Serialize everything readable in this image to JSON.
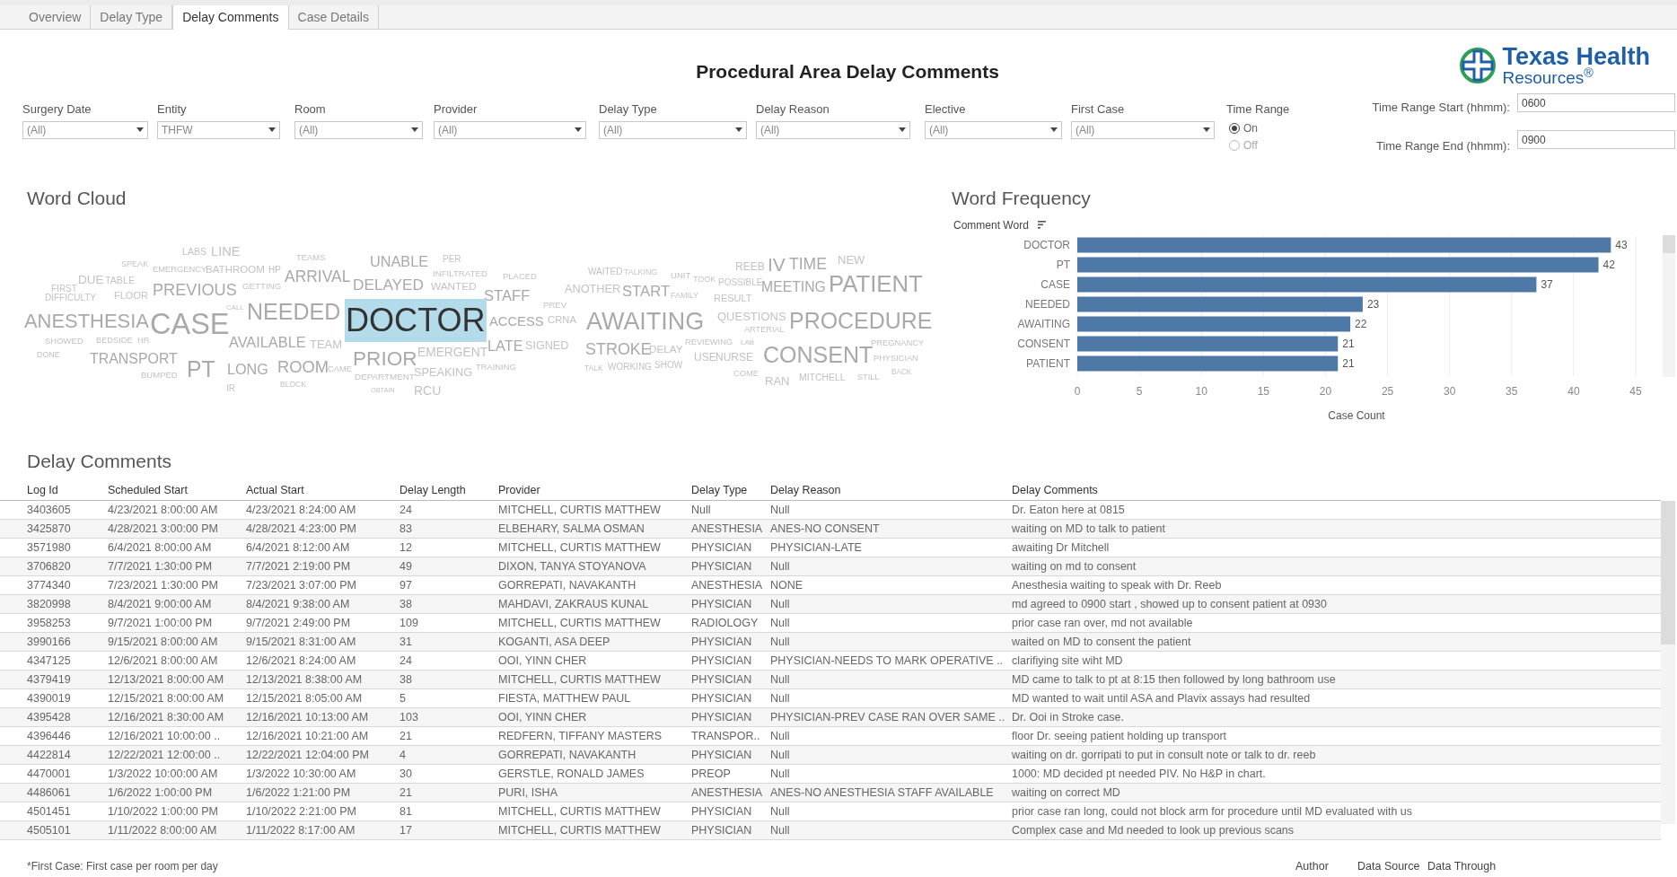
{
  "tabs": [
    {
      "label": "Overview",
      "selected": false
    },
    {
      "label": "Delay Type",
      "selected": false
    },
    {
      "label": "Delay Comments",
      "selected": true
    },
    {
      "label": "Case Details",
      "selected": false
    }
  ],
  "title": "Procedural Area Delay Comments",
  "logo": {
    "line_1": "Texas Health",
    "line_2": "Resources$^{®}$"
  },
  "filters": [
    {
      "label": "Surgery Date",
      "value": "(All)"
    },
    {
      "label": "Entity",
      "value": "THFW"
    },
    {
      "label": "Room",
      "value": "(All)"
    },
    {
      "label": "Provider",
      "value": "(All)"
    },
    {
      "label": "Delay Type",
      "value": "(All)"
    },
    {
      "label": "Delay Reason",
      "value": "(All)"
    },
    {
      "label": "Elective",
      "value": "(All)"
    },
    {
      "label": "First Case",
      "value": "(All)"
    }
  ],
  "time_range": {
    "label": "Time Range",
    "options": [
      {
        "label": "On",
        "selected": true
      },
      {
        "label": "Off",
        "selected": false
      }
    ]
  },
  "time_inputs": [
    {
      "label": "Time Range Start (hhmm):",
      "value": "0600"
    },
    {
      "label": "Time Range End (hhmm):",
      "value": "0900"
    }
  ],
  "word_cloud": {
    "title": "Word Cloud",
    "words": [
      {
        "text": "LABS",
        "selected": false
      },
      {
        "text": "LINE",
        "selected": false
      },
      {
        "text": "TEAMS",
        "selected": false
      },
      {
        "text": "UNABLE",
        "selected": false
      },
      {
        "text": "PER",
        "selected": false
      },
      {
        "text": "SPEAK",
        "selected": false
      },
      {
        "text": "EMERGENCY",
        "selected": false
      },
      {
        "text": "BATHROOM",
        "selected": false
      },
      {
        "text": "HP",
        "selected": false
      },
      {
        "text": "ARRIVAL",
        "selected": false
      },
      {
        "text": "INFILTRATED",
        "selected": false
      },
      {
        "text": "PLACED",
        "selected": false
      },
      {
        "text": "WAITED",
        "selected": false
      },
      {
        "text": "TALKING",
        "selected": false
      },
      {
        "text": "UNIT",
        "selected": false
      },
      {
        "text": "TOOK",
        "selected": false
      },
      {
        "text": "REEB",
        "selected": false
      },
      {
        "text": "IV",
        "selected": false
      },
      {
        "text": "TIME",
        "selected": false
      },
      {
        "text": "NEW",
        "selected": false
      },
      {
        "text": "FIRST",
        "selected": false
      },
      {
        "text": "DUE",
        "selected": false
      },
      {
        "text": "TABLE",
        "selected": false
      },
      {
        "text": "DIFFICULTY",
        "selected": false
      },
      {
        "text": "FLOOR",
        "selected": false
      },
      {
        "text": "PREVIOUS",
        "selected": false
      },
      {
        "text": "GETTING",
        "selected": false
      },
      {
        "text": "DELAYED",
        "selected": false
      },
      {
        "text": "WANTED",
        "selected": false
      },
      {
        "text": "STAFF",
        "selected": false
      },
      {
        "text": "ANOTHER",
        "selected": false
      },
      {
        "text": "START",
        "selected": false
      },
      {
        "text": "FAMILY",
        "selected": false
      },
      {
        "text": "POSSIBLE",
        "selected": false
      },
      {
        "text": "RESULT",
        "selected": false
      },
      {
        "text": "MEETING",
        "selected": false
      },
      {
        "text": "PATIENT",
        "selected": false
      },
      {
        "text": "ANESTHESIA",
        "selected": false
      },
      {
        "text": "CASE",
        "selected": false
      },
      {
        "text": "CALL",
        "selected": false
      },
      {
        "text": "NEEDED",
        "selected": false
      },
      {
        "text": "DOCTOR",
        "selected": true
      },
      {
        "text": "ACCESS",
        "selected": false
      },
      {
        "text": "PREV",
        "selected": false
      },
      {
        "text": "CRNA",
        "selected": false
      },
      {
        "text": "AWAITING",
        "selected": false
      },
      {
        "text": "QUESTIONS",
        "selected": false
      },
      {
        "text": "ARTERIAL",
        "selected": false
      },
      {
        "text": "PROCEDURE",
        "selected": false
      },
      {
        "text": "SHOWED",
        "selected": false
      },
      {
        "text": "BEDSIDE",
        "selected": false
      },
      {
        "text": "HR",
        "selected": false
      },
      {
        "text": "AVAILABLE",
        "selected": false
      },
      {
        "text": "TEAM",
        "selected": false
      },
      {
        "text": "LATE",
        "selected": false
      },
      {
        "text": "SIGNED",
        "selected": false
      },
      {
        "text": "STROKE",
        "selected": false
      },
      {
        "text": "DELAY",
        "selected": false
      },
      {
        "text": "REVIEWING",
        "selected": false
      },
      {
        "text": "LAB",
        "selected": false
      },
      {
        "text": "PREGNANCY",
        "selected": false
      },
      {
        "text": "DONE",
        "selected": false
      },
      {
        "text": "TRANSPORT",
        "selected": false
      },
      {
        "text": "BUMPED",
        "selected": false
      },
      {
        "text": "PT",
        "selected": false
      },
      {
        "text": "LONG",
        "selected": false
      },
      {
        "text": "IR",
        "selected": false
      },
      {
        "text": "ROOM",
        "selected": false
      },
      {
        "text": "BLOCK",
        "selected": false
      },
      {
        "text": "CAME",
        "selected": false
      },
      {
        "text": "PRIOR",
        "selected": false
      },
      {
        "text": "EMERGENT",
        "selected": false
      },
      {
        "text": "DEPARTMENT",
        "selected": false
      },
      {
        "text": "SPEAKING",
        "selected": false
      },
      {
        "text": "OBTAIN",
        "selected": false
      },
      {
        "text": "RCU",
        "selected": false
      },
      {
        "text": "TRAINING",
        "selected": false
      },
      {
        "text": "TALK",
        "selected": false
      },
      {
        "text": "WORKING",
        "selected": false
      },
      {
        "text": "SHOW",
        "selected": false
      },
      {
        "text": "USE",
        "selected": false
      },
      {
        "text": "NURSE",
        "selected": false
      },
      {
        "text": "COME",
        "selected": false
      },
      {
        "text": "CONSENT",
        "selected": false
      },
      {
        "text": "RAN",
        "selected": false
      },
      {
        "text": "MITCHELL",
        "selected": false
      },
      {
        "text": "STILL",
        "selected": false
      },
      {
        "text": "PHYSICIAN",
        "selected": false
      },
      {
        "text": "BACK",
        "selected": false
      }
    ]
  },
  "word_frequency": {
    "title": "Word Frequency",
    "chart_data": {
      "type": "bar",
      "orientation": "horizontal",
      "ylabel": "Comment Word",
      "xlabel": "Case Count",
      "categories": [
        "DOCTOR",
        "PT",
        "CASE",
        "NEEDED",
        "AWAITING",
        "CONSENT",
        "PATIENT"
      ],
      "values": [
        43,
        42,
        37,
        23,
        22,
        21,
        21
      ],
      "xlim": [
        0,
        45
      ],
      "xticks": [
        0,
        5,
        10,
        15,
        20,
        25,
        30,
        35,
        40,
        45
      ],
      "grid": true,
      "data_labels": true
    }
  },
  "delay_comments": {
    "title": "Delay Comments",
    "columns": [
      "Log Id",
      "Scheduled Start",
      "Actual Start",
      "Delay Length",
      "Provider",
      "Delay Type",
      "Delay Reason",
      "Delay Comments"
    ],
    "rows": [
      [
        "3403605",
        "4/23/2021 8:00:00 AM",
        "4/23/2021 8:24:00 AM",
        "24",
        "MITCHELL, CURTIS MATTHEW",
        "Null",
        "Null",
        "Dr. Eaton here at 0815"
      ],
      [
        "3425870",
        "4/28/2021 3:00:00 PM",
        "4/28/2021 4:23:00 PM",
        "83",
        "ELBEHARY, SALMA OSMAN",
        "ANESTHESIA",
        "ANES-NO CONSENT",
        "waiting on MD to talk to patient"
      ],
      [
        "3571980",
        "6/4/2021 8:00:00 AM",
        "6/4/2021 8:12:00 AM",
        "12",
        "MITCHELL, CURTIS MATTHEW",
        "PHYSICIAN",
        "PHYSICIAN-LATE",
        "awaiting Dr Mitchell"
      ],
      [
        "3706820",
        "7/7/2021 1:30:00 PM",
        "7/7/2021 2:19:00 PM",
        "49",
        "DIXON, TANYA STOYANOVA",
        "PHYSICIAN",
        "Null",
        "waiting on md to consent"
      ],
      [
        "3774340",
        "7/23/2021 1:30:00 PM",
        "7/23/2021 3:07:00 PM",
        "97",
        "GORREPATI, NAVAKANTH",
        "ANESTHESIA",
        "NONE",
        "Anesthesia waiting to speak with Dr. Reeb"
      ],
      [
        "3820998",
        "8/4/2021 9:00:00 AM",
        "8/4/2021 9:38:00 AM",
        "38",
        "MAHDAVI, ZAKRAUS KUNAL",
        "PHYSICIAN",
        "Null",
        "md agreed to 0900 start , showed up to consent patient at 0930"
      ],
      [
        "3958253",
        "9/7/2021 1:00:00 PM",
        "9/7/2021 2:49:00 PM",
        "109",
        "MITCHELL, CURTIS MATTHEW",
        "RADIOLOGY",
        "Null",
        "prior case ran over, md not available"
      ],
      [
        "3990166",
        "9/15/2021 8:00:00 AM",
        "9/15/2021 8:31:00 AM",
        "31",
        "KOGANTI, ASA DEEP",
        "PHYSICIAN",
        "Null",
        "waited on MD to consent the patient"
      ],
      [
        "4347125",
        "12/6/2021 8:00:00 AM",
        "12/6/2021 8:24:00 AM",
        "24",
        "OOI, YINN CHER",
        "PHYSICIAN",
        "PHYSICIAN-NEEDS TO MARK OPERATIVE ..",
        "clarifiying site wiht MD"
      ],
      [
        "4379419",
        "12/13/2021 8:00:00 AM",
        "12/13/2021 8:38:00 AM",
        "38",
        "MITCHELL, CURTIS MATTHEW",
        "PHYSICIAN",
        "Null",
        "MD came to talk to pt at 8:15 then followed by long bathroom use"
      ],
      [
        "4390019",
        "12/15/2021 8:00:00 AM",
        "12/15/2021 8:05:00 AM",
        "5",
        "FIESTA, MATTHEW PAUL",
        "PHYSICIAN",
        "Null",
        "MD wanted to wait until ASA and Plavix assays had resulted"
      ],
      [
        "4395428",
        "12/16/2021 8:30:00 AM",
        "12/16/2021 10:13:00 AM",
        "103",
        "OOI, YINN CHER",
        "PHYSICIAN",
        "PHYSICIAN-PREV CASE RAN OVER SAME ..",
        "Dr. Ooi in Stroke case."
      ],
      [
        "4396446",
        "12/16/2021 10:00:00 ..",
        "12/16/2021 10:21:00 AM",
        "21",
        "REDFERN, TIFFANY MASTERS",
        "TRANSPOR..",
        "Null",
        "floor Dr. seeing patient holding up transport"
      ],
      [
        "4422814",
        "12/22/2021 12:00:00 ..",
        "12/22/2021 12:04:00 PM",
        "4",
        "GORREPATI, NAVAKANTH",
        "PHYSICIAN",
        "Null",
        "waiting on dr. gorripati to put in consult note or talk to dr. reeb"
      ],
      [
        "4470001",
        "1/3/2022 10:00:00 AM",
        "1/3/2022 10:30:00 AM",
        "30",
        "GERSTLE, RONALD JAMES",
        "PREOP",
        "Null",
        "1000: MD decided pt needed PIV. No H&P in chart."
      ],
      [
        "4486061",
        "1/6/2022 1:00:00 PM",
        "1/6/2022 1:21:00 PM",
        "21",
        "PURI, ISHA",
        "ANESTHESIA",
        "ANES-NO ANESTHESIA STAFF AVAILABLE",
        "waiting on correct MD"
      ],
      [
        "4501451",
        "1/10/2022 1:00:00 PM",
        "1/10/2022 2:21:00 PM",
        "81",
        "MITCHELL, CURTIS MATTHEW",
        "PHYSICIAN",
        "Null",
        "prior case ran long, could not block arm for procedure until MD evaluated with us"
      ],
      [
        "4505101",
        "1/11/2022 8:00:00 AM",
        "1/11/2022 8:17:00 AM",
        "17",
        "MITCHELL, CURTIS MATTHEW",
        "PHYSICIAN",
        "Null",
        "Complex case and Md needed to look up previous scans"
      ]
    ]
  },
  "footer": {
    "note": "*First Case: First case per room per day",
    "labels": [
      "Author",
      "Data Source",
      "Data Through"
    ]
  }
}
